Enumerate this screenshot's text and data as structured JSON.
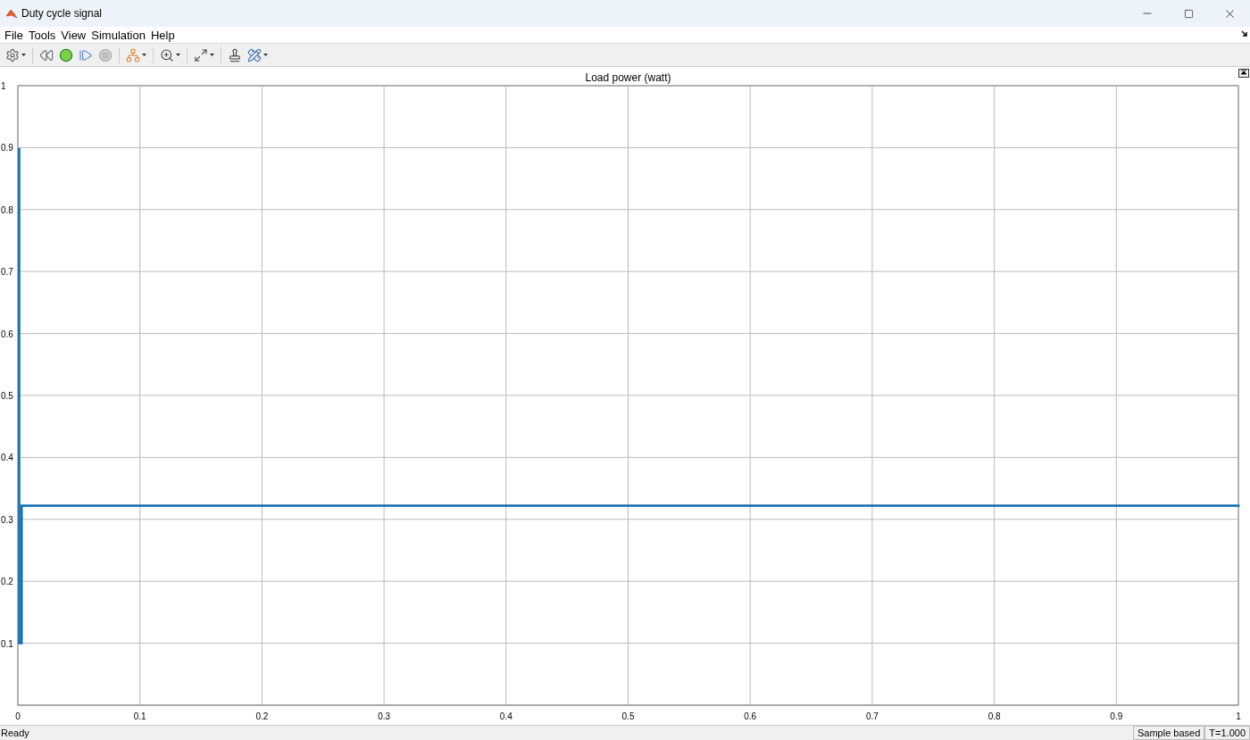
{
  "window": {
    "title": "Duty cycle signal"
  },
  "menu": [
    "File",
    "Tools",
    "View",
    "Simulation",
    "Help"
  ],
  "toolbar": [
    {
      "kind": "settings",
      "caret": true
    },
    {
      "kind": "step-back",
      "caret": false
    },
    {
      "kind": "run",
      "caret": false
    },
    {
      "kind": "step-forward",
      "caret": false
    },
    {
      "kind": "stop",
      "caret": false,
      "disabled": true
    },
    {
      "kind": "diagram",
      "caret": true
    },
    {
      "kind": "zoom",
      "caret": true
    },
    {
      "kind": "fit",
      "caret": true
    },
    {
      "kind": "stamp",
      "caret": false
    },
    {
      "kind": "measure",
      "caret": true
    }
  ],
  "plot": {
    "chart_data": {
      "type": "line",
      "title": "Load power (watt)",
      "grid": true,
      "xlim": [
        0,
        1
      ],
      "ylim": [
        0,
        1
      ],
      "xticks": [
        {
          "value": 0,
          "label": "0"
        },
        {
          "value": 0.1,
          "label": "0.1"
        },
        {
          "value": 0.2,
          "label": "0.2"
        },
        {
          "value": 0.3,
          "label": "0.3"
        },
        {
          "value": 0.4,
          "label": "0.4"
        },
        {
          "value": 0.5,
          "label": "0.5"
        },
        {
          "value": 0.6,
          "label": "0.6"
        },
        {
          "value": 0.7,
          "label": "0.7"
        },
        {
          "value": 0.8,
          "label": "0.8"
        },
        {
          "value": 0.9,
          "label": "0.9"
        },
        {
          "value": 1,
          "label": "1"
        }
      ],
      "yticks": [
        {
          "value": 0.1,
          "label": "0.1"
        },
        {
          "value": 0.2,
          "label": "0.2"
        },
        {
          "value": 0.3,
          "label": "0.3"
        },
        {
          "value": 0.4,
          "label": "0.4"
        },
        {
          "value": 0.5,
          "label": "0.5"
        },
        {
          "value": 0.6,
          "label": "0.6"
        },
        {
          "value": 0.7,
          "label": "0.7"
        },
        {
          "value": 0.8,
          "label": "0.8"
        },
        {
          "value": 0.9,
          "label": "0.9"
        },
        {
          "value": 1,
          "label": "1"
        }
      ],
      "x": [
        0,
        0,
        0.002,
        0.002,
        1
      ],
      "series": [
        {
          "color": "#0b6bb0",
          "values": [
            0.9,
            0.1,
            0.1,
            0.322,
            0.322
          ]
        }
      ]
    }
  },
  "status_bar": {
    "status": "Ready",
    "mode": "Sample based",
    "time": "T=1.000"
  }
}
